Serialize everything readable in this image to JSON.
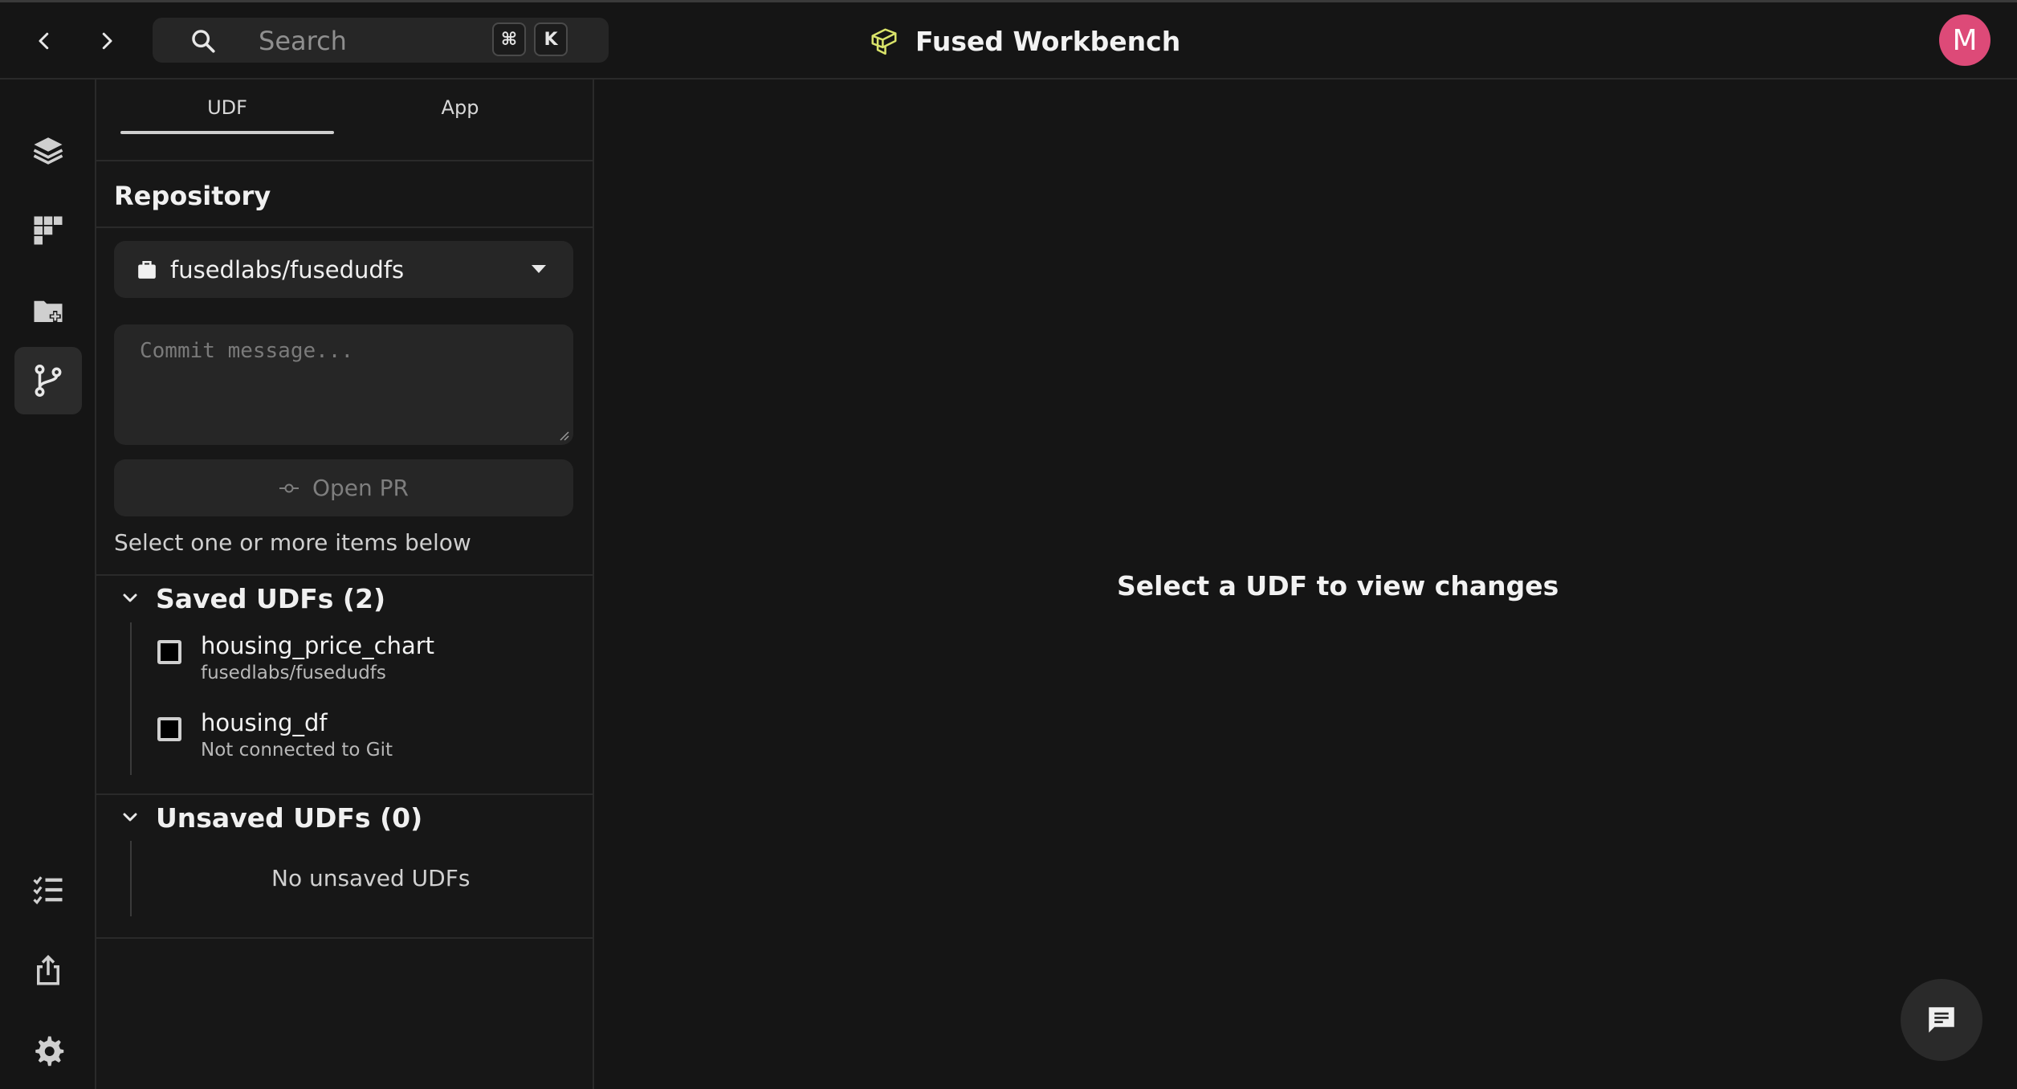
{
  "app": {
    "title": "Fused Workbench",
    "user_initial": "M",
    "avatar_color": "#dd4a78",
    "brand_color": "#d9e36a"
  },
  "search": {
    "placeholder": "Search",
    "shortcut_mod": "⌘",
    "shortcut_key": "K"
  },
  "icons": {
    "back": "chevron-left-icon",
    "forward": "chevron-right-icon",
    "search": "magnifier-icon",
    "rail": [
      "layers-icon",
      "grid-icon",
      "folder-add-icon",
      "git-branch-icon",
      "checklist-icon",
      "share-icon",
      "gear-icon"
    ],
    "chat": "chat-bubble-icon"
  },
  "panel": {
    "tabs": [
      "UDF",
      "App"
    ],
    "active_tab": "UDF",
    "repository_title": "Repository",
    "repo_name": "fusedlabs/fusedudfs",
    "commit_placeholder": "Commit message...",
    "open_pr_label": "Open PR",
    "hint": "Select one or more items below",
    "saved_section": "Saved UDFs (2)",
    "saved_items": [
      {
        "name": "housing_price_chart",
        "sub": "fusedlabs/fusedudfs"
      },
      {
        "name": "housing_df",
        "sub": "Not connected to Git"
      }
    ],
    "unsaved_section": "Unsaved UDFs (0)",
    "unsaved_empty": "No unsaved UDFs"
  },
  "main": {
    "empty_message": "Select a UDF to view changes"
  }
}
